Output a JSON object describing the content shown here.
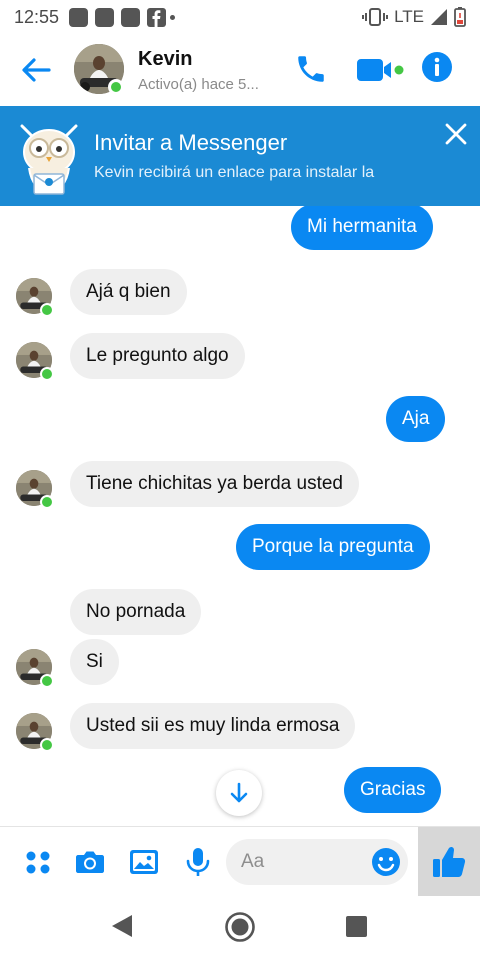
{
  "status_bar": {
    "time": "12:55",
    "network": "LTE",
    "icons": [
      "notification-square-icon",
      "notification-square-icon",
      "notification-square-icon",
      "facebook-icon",
      "dot-icon",
      "vibrate-icon",
      "signal-icon",
      "battery-low-icon"
    ]
  },
  "header": {
    "name": "Kevin",
    "status": "Activo(a) hace 5..."
  },
  "banner": {
    "title": "Invitar a Messenger",
    "subtitle": "Kevin recibirá un enlace para instalar la"
  },
  "messages": [
    {
      "text": "Mi hermanita",
      "dir": "out"
    },
    {
      "text": "Ajá q bien",
      "dir": "in"
    },
    {
      "text": "Le pregunto algo",
      "dir": "in"
    },
    {
      "text": "Aja",
      "dir": "out"
    },
    {
      "text": "Tiene chichitas ya berda usted",
      "dir": "in"
    },
    {
      "text": "Porque la pregunta",
      "dir": "out"
    },
    {
      "text": "No pornada",
      "dir": "in"
    },
    {
      "text": "Si",
      "dir": "in"
    },
    {
      "text": "Usted sii es muy linda ermosa",
      "dir": "in"
    },
    {
      "text": "Gracias",
      "dir": "out"
    }
  ],
  "composer": {
    "placeholder": "Aa"
  },
  "colors": {
    "accent": "#0a88f2",
    "banner": "#1b8ad4",
    "online": "#44c744",
    "incoming_bubble": "#efefef"
  }
}
